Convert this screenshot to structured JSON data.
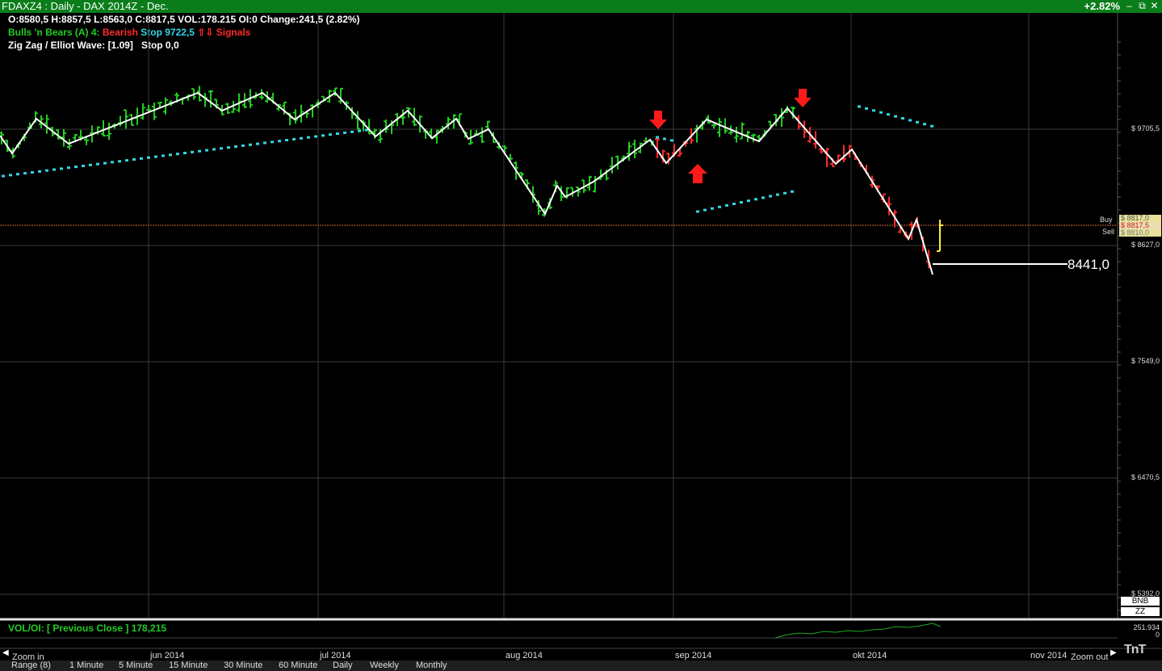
{
  "window": {
    "title": "FDAXZ4 : Daily  -  DAX 2014Z - Dec.",
    "change_badge": "+2.82%",
    "buttons": {
      "minimize": "–",
      "restore": "⧉",
      "close": "✕"
    }
  },
  "info": {
    "ohlc": "O:8580,5   H:8857,5   L:8563,0   C:8817,5   VOL:178.215   OI:0   Change:241,5 (2.82%)",
    "bnb_label": "Bulls 'n Bears (A) 4:",
    "bnb_state": "Bearish",
    "bnb_stop": "Stop 9722,5",
    "bnb_signals": "⇧⇩ Signals",
    "zz_label": "Zig Zag / Elliot Wave: [1.09]",
    "zz_stop": "Stop 0,0"
  },
  "price_axis": {
    "labels": [
      "$ 9705,5",
      "$ 8627,0",
      "$ 7549,0",
      "$ 6470,5",
      "$ 5392,0"
    ],
    "buy_label": "Buy",
    "sell_label": "Sell",
    "buy_price": "$ 8817,5",
    "buy_price_hidden": "$ 8817,0",
    "sell_price": "$ 8810,0",
    "low_annotation": "8441,0"
  },
  "side_buttons": [
    "BNB",
    "ZZ"
  ],
  "volume_pane": {
    "label": "VOL/OI:  [ Previous Close ] 178,215",
    "axis_top": "251.934",
    "axis_bottom": "0"
  },
  "date_axis": [
    "jun 2014",
    "jul 2014",
    "aug 2014",
    "sep 2014",
    "okt 2014",
    "nov 2014"
  ],
  "bottom_bar": {
    "zoom_in": "Zoom in",
    "zoom_out": "Zoom out",
    "ranges": [
      "Range (8)",
      "1 Minute",
      "5 Minute",
      "15 Minute",
      "30 Minute",
      "60 Minute",
      "Daily",
      "Weekly",
      "Monthly"
    ],
    "logo": "TnT"
  },
  "colors": {
    "titlebar": "#0a7d1a",
    "bull": "#22cc22",
    "bear": "#ff2a2a",
    "stop": "#33d6e6",
    "zigzag": "#ffffff",
    "last_bar": "#ffee33",
    "grid": "#3a3a3a"
  }
}
